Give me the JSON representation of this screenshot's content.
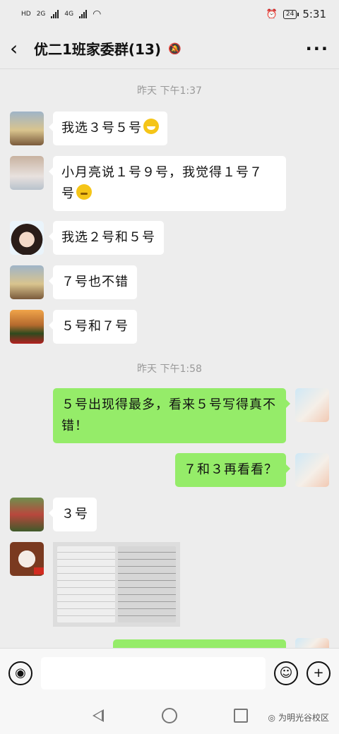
{
  "status_bar": {
    "left_labels": [
      "HD",
      "2G",
      "4G"
    ],
    "battery": "24",
    "time": "5:31"
  },
  "header": {
    "back_icon": "chevron-left-icon",
    "title": "优二1班家委群(13)",
    "mute_icon": "bell-muted-icon",
    "more_icon": "more-dots-icon"
  },
  "chat": {
    "timestamps": [
      "昨天 下午1:37",
      "昨天 下午1:58"
    ],
    "messages": [
      {
        "side": "left",
        "avatar": "girls-walking",
        "text": "我选３号５号",
        "emoji": "grin-emoji"
      },
      {
        "side": "left",
        "avatar": "plush-bear",
        "text_line1": "小月亮说１号９号，我觉得１号７",
        "text_line2": "号",
        "emoji": "thinking-emoji"
      },
      {
        "side": "left",
        "avatar": "girl-face",
        "text": "我选２号和５号"
      },
      {
        "side": "left",
        "avatar": "girls-walking",
        "text": "７号也不错"
      },
      {
        "side": "left",
        "avatar": "sunset-field",
        "text": "５号和７号"
      },
      {
        "side": "right",
        "avatar": "baby",
        "text_line1": "５号出现得最多，看来５号写得真不",
        "text_line2": "错！"
      },
      {
        "side": "right",
        "avatar": "baby",
        "text": "７和３再看看？"
      },
      {
        "side": "left",
        "avatar": "flowers",
        "text": "３号"
      },
      {
        "side": "left",
        "avatar": "coffee-cup",
        "image": "handwriting-photo"
      }
    ]
  },
  "input_bar": {
    "voice_icon": "voice-icon",
    "emoji_icon": "smiley-icon",
    "plus_icon": "plus-icon"
  },
  "nav": {
    "back_icon": "nav-back-icon",
    "home_icon": "nav-home-icon",
    "recent_icon": "nav-recent-icon"
  },
  "watermark": "为明光谷校区"
}
